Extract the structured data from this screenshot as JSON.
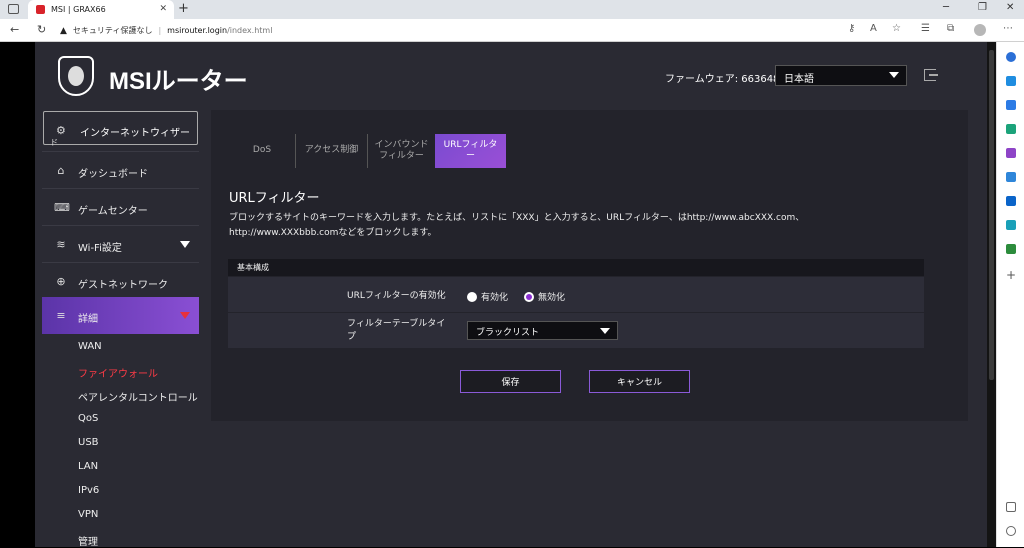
{
  "browser": {
    "tab_title": "MSI | GRAX66",
    "security_label": "セキュリティ保護なし",
    "url_host": "msirouter.login",
    "url_path": "/index.html"
  },
  "header": {
    "brand": "MSIルーター",
    "firmware": "ファームウェア: 663648",
    "language": "日本語"
  },
  "sidebar": {
    "wizard": "インターネットウィザー",
    "wizard_tail": "ド",
    "items": [
      {
        "label": "ダッシュボード",
        "icon": "home-icon"
      },
      {
        "label": "ゲームセンター",
        "icon": "gamepad-icon"
      },
      {
        "label": "Wi-Fi設定",
        "icon": "wifi-icon"
      },
      {
        "label": "ゲストネットワーク",
        "icon": "globe-icon"
      },
      {
        "label": "詳細",
        "icon": "sliders-icon"
      }
    ],
    "subitems": [
      "WAN",
      "ファイアウォール",
      "ペアレンタルコントロール",
      "QoS",
      "USB",
      "LAN",
      "IPv6",
      "VPN",
      "管理"
    ]
  },
  "tabs": [
    "DoS",
    "アクセス制御",
    "インバウンド\nフィルター",
    "URLフィルタ\nー"
  ],
  "main": {
    "title": "URLフィルター",
    "desc_line1": "ブロックするサイトのキーワードを入力します。たとえば、リストに「XXX」と入力すると、URLフィルター、はhttp://www.abcXXX.com、",
    "desc_line2": "http://www.XXXbbb.comなどをブロックします。",
    "section_title": "基本構成",
    "enable_label": "URLフィルターの有効化",
    "radio_enable": "有効化",
    "radio_disable": "無効化",
    "type_label_line1": "フィルターテーブルタイ",
    "type_label_line2": "プ",
    "type_value": "ブラックリスト",
    "save": "保存",
    "cancel": "キャンセル"
  },
  "colors": {
    "accent": "#7a4bd0",
    "active_red": "#ff3b46"
  }
}
